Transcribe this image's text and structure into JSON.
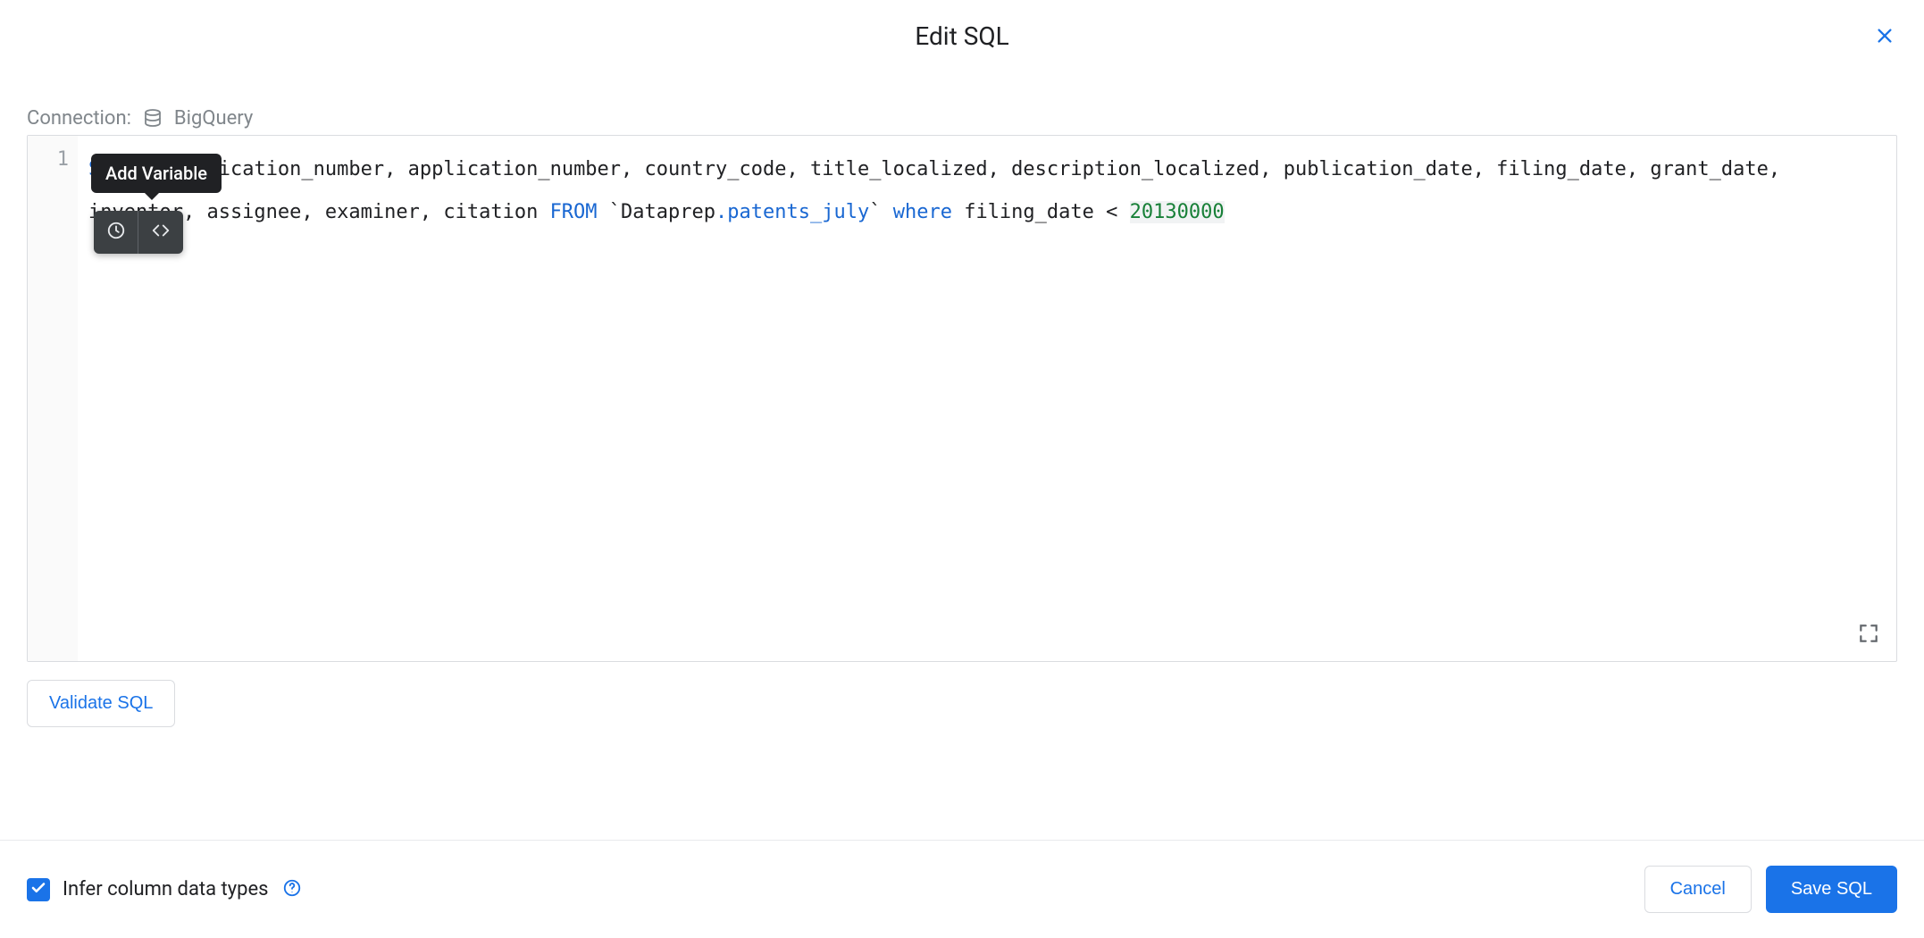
{
  "header": {
    "title": "Edit SQL"
  },
  "connection": {
    "label": "Connection:",
    "name": "BigQuery"
  },
  "tooltip": {
    "text": "Add Variable"
  },
  "editor": {
    "gutter": "1",
    "tokens": {
      "select": "SELECT",
      "cols": " publication_number, application_number, country_code, title_localized, description_localized, publication_date, filing_date, grant_date, inventor, assignee, examiner, citation ",
      "from": "FROM",
      "space1": " ",
      "tick1": "`",
      "db": "Dataprep",
      "dot": ".",
      "table": "patents_july",
      "tick2": "`",
      "space2": " ",
      "where": "where",
      "cond": " filing_date < ",
      "num": "20130000"
    }
  },
  "buttons": {
    "validate": "Validate SQL",
    "cancel": "Cancel",
    "save": "Save SQL"
  },
  "footer": {
    "infer_label": "Infer column data types"
  }
}
